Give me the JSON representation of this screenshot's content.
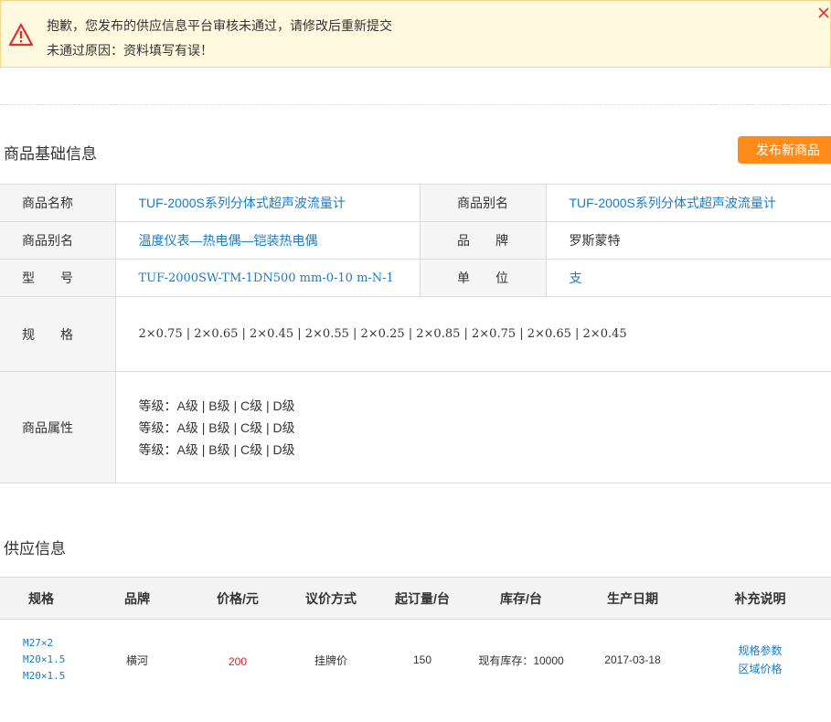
{
  "alert": {
    "message": "抱歉，您发布的供应信息平台审核未通过，请修改后重新提交",
    "reason": "未通过原因：资料填写有误！"
  },
  "basic": {
    "title": "商品基础信息",
    "publish_label": "发布新商品",
    "rows": {
      "name_label": "商品名称",
      "name_value": "TUF-2000S系列分体式超声波流量计",
      "alias_label": "商品别名",
      "alias_value": "TUF-2000S系列分体式超声波流量计",
      "alias2_label": "商品别名",
      "alias2_value": "温度仪表—热电偶—铠装热电偶",
      "brand_label": "品　　牌",
      "brand_value": "罗斯蒙特",
      "model_label": "型　　号",
      "model_value": "TUF-2000SW-TM-1DN500 mm-0-10 m-N-1",
      "unit_label": "单　　位",
      "unit_value": "支",
      "spec_label": "规　　格",
      "spec_value": "2×0.75 | 2×0.65 | 2×0.45 | 2×0.55 | 2×0.25 | 2×0.85 | 2×0.75 | 2×0.65 | 2×0.45",
      "attr_label": "商品属性",
      "attr_lines": [
        "等级：A级 | B级 | C级 | D级",
        "等级：A级 | B级 | C级 | D级",
        "等级：A级 | B级 | C级 | D级"
      ]
    }
  },
  "supply": {
    "title": "供应信息",
    "headers": [
      "规格",
      "品牌",
      "价格/元",
      "议价方式",
      "起订量/台",
      "库存/台",
      "生产日期",
      "补充说明"
    ],
    "row": {
      "specs": [
        "M27×2",
        "M20×1.5",
        "M20×1.5"
      ],
      "brand": "横河",
      "price": "200",
      "bargain": "挂牌价",
      "moq": "150",
      "stock": "现有库存：10000",
      "date": "2017-03-18",
      "link1": "规格参数",
      "link2": "区域价格"
    }
  },
  "icons": {
    "alert": "warning-triangle-icon",
    "close": "close-icon"
  },
  "colors": {
    "accent": "#ff8c1a",
    "link": "#1a7bc8",
    "price": "#e02020",
    "alert_bg": "#fff9e0"
  }
}
